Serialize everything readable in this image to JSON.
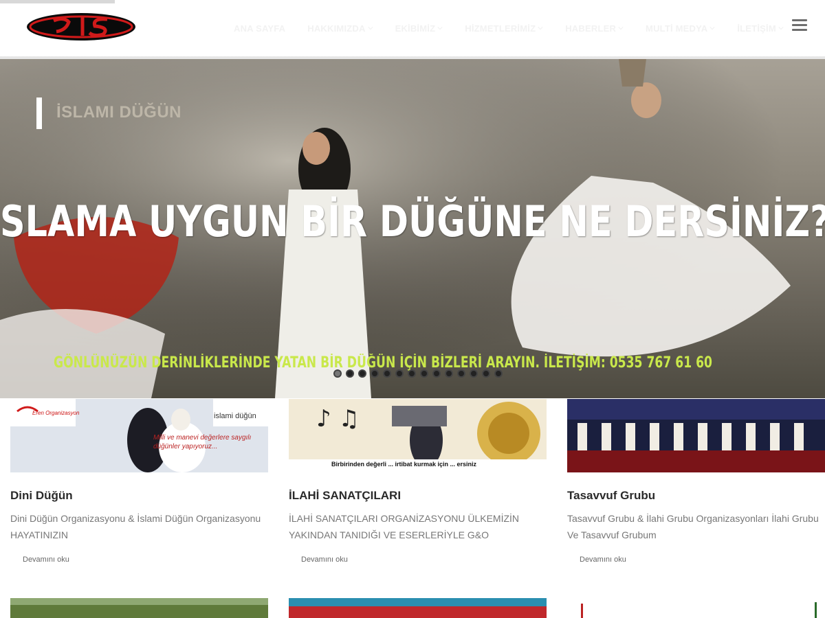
{
  "header": {
    "logo_alt": "logo",
    "nav": [
      {
        "label": "ANA SAYFA",
        "has_dropdown": false
      },
      {
        "label": "HAKKIMIZDA",
        "has_dropdown": true
      },
      {
        "label": "EKİBİMİZ",
        "has_dropdown": true
      },
      {
        "label": "HİZMETLERİMİZ",
        "has_dropdown": true
      },
      {
        "label": "HABERLER",
        "has_dropdown": true
      },
      {
        "label": "MULTİ MEDYA",
        "has_dropdown": true
      },
      {
        "label": "İLETİŞİM",
        "has_dropdown": true
      }
    ],
    "menu_icon": "hamburger-icon"
  },
  "hero": {
    "title": "İSLAMI DÜĞÜN",
    "headline": "SLAMA UYGUN BİR DÜĞÜNE NE DERSİNİZ?",
    "subline": "GÖNLÜNÜZÜN DERİNLİKLERİNDE YATAN BİR DÜĞÜN İÇİN BİZLERİ ARAYIN. İLETİŞİM: 0535 767 61 60",
    "slide_count": 14,
    "active_slide": 1
  },
  "cards": [
    {
      "title": "Dini Düğün",
      "text": "Dini Düğün Organizasyonu & İslami Düğün Organizasyonu HAYATINIZIN",
      "more": "Devamını oku",
      "image_caption": "Milli ve manevi değerlere saygılı düğünler yapıyoruz...",
      "image_badge": "islami düğün",
      "image_brand": "Eren Organizasyon"
    },
    {
      "title": "İLAHİ SANATÇILARI",
      "text": "İLAHİ SANATÇILARI ORGANİZASYONU ÜLKEMİZİN YAKINDAN TANIDIĞI VE ESERLERİYLE G&O",
      "more": "Devamını oku",
      "image_caption": "Birbirinden değerli ... irtibat kurmak için ... ersiniz"
    },
    {
      "title": "Tasavvuf Grubu",
      "text": "Tasavvuf Grubu & İlahi Grubu Organizasyonları    İlahi Grubu Ve Tasavvuf Grubum",
      "more": "Devamını oku"
    }
  ],
  "colors": {
    "nav_text": "#f2f2f2",
    "logo_red": "#d01a1a",
    "hero_sub": "#c9e84b",
    "card_title": "#2a2a2a",
    "card_text": "#777777"
  }
}
